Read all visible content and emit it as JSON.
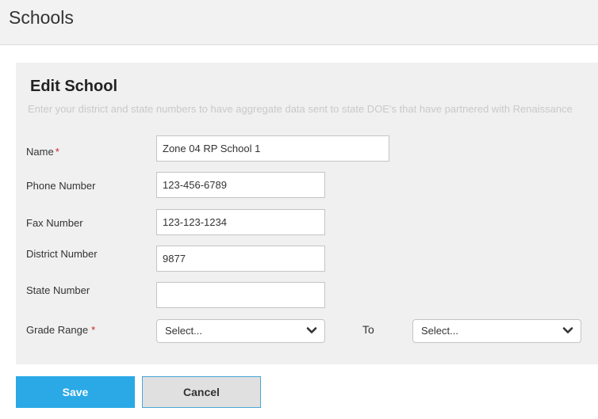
{
  "page": {
    "title": "Schools"
  },
  "form": {
    "title": "Edit School",
    "description": "Enter your district and state numbers to have aggregate data sent to state DOE's that have partnered with Renaissance",
    "required_marker": "*",
    "fields": {
      "name": {
        "label": "Name",
        "value": "Zone 04 RP School 1",
        "required": true
      },
      "phone": {
        "label": "Phone Number",
        "value": "123-456-6789"
      },
      "fax": {
        "label": "Fax Number",
        "value": "123-123-1234"
      },
      "district": {
        "label": "District Number",
        "value": "9877"
      },
      "state": {
        "label": "State Number",
        "value": ""
      },
      "grade_range": {
        "label": "Grade Range",
        "required": true,
        "from_value": "Select...",
        "to_label": "To",
        "to_value": "Select..."
      }
    }
  },
  "actions": {
    "save_label": "Save",
    "cancel_label": "Cancel"
  },
  "colors": {
    "primary": "#2aa9e6",
    "required": "#cc2222",
    "panel_bg": "#f0f0f0"
  },
  "icons": {
    "select_indicator": "chevron-down-icon"
  }
}
